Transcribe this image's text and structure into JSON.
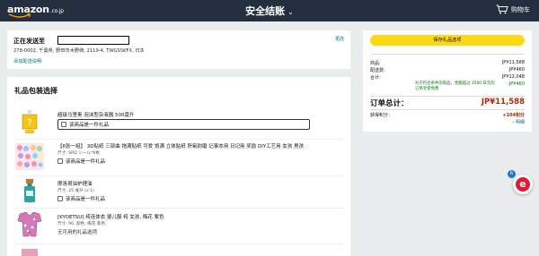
{
  "header": {
    "logo_text": "amazon",
    "logo_tld": ".co.jp",
    "title": "安全结账",
    "cart_label": "购物车"
  },
  "shipping": {
    "heading": "正在发送至",
    "change_label": "更改",
    "address": "278-0002, 千葉県, 野田市木野崎, 2119-4, TWGSSKFX, 日本",
    "add_note_label": "添加配送说明"
  },
  "gift": {
    "heading": "礼品包装选择",
    "checkbox_label": "该商品是一件礼品",
    "items": [
      {
        "title": "超级马里奥 泡沫型杂液器 500毫升",
        "meta": ""
      },
      {
        "title": "【6张一组】 3D贴纸 三部曲 拖满贴纸 可爱 饱满 立体贴纸 肝氧耐磨 记事本用 日记用 奖励 DIY工艺用 女孩 男孩",
        "meta": "尺寸: SRD シール*6枚"
      },
      {
        "title": "摩洛哥油护理油",
        "meta": "尺寸: 25 毫升 (x 1)"
      },
      {
        "title": "[KYOETSU] 袴连体衣 婴儿服 袴 女孩, 梅花 紫色",
        "meta": "尺寸: 90,   颜色: 梅花 紫色",
        "no_options": "无可用的礼品选项"
      }
    ]
  },
  "summary": {
    "cta_label": "保存礼品选项",
    "rows": [
      {
        "label": "商品:",
        "value": "JP¥11,588"
      },
      {
        "label": "配送费:",
        "value": "JP¥460"
      },
      {
        "label": "合计:",
        "value": "JP¥12,048"
      },
      {
        "label": "",
        "value": "-JP¥460"
      }
    ],
    "free_ship_note": "对于符合条件的商品，金额超过 3500 日元的订单享受免费",
    "total_label": "订单总计：",
    "total_value": "JP¥11,588",
    "points_label": "获得积分：",
    "points_value": "+104积分",
    "points_detail": "› 明细"
  },
  "widget": {
    "badge": "6",
    "glyph": "e"
  }
}
